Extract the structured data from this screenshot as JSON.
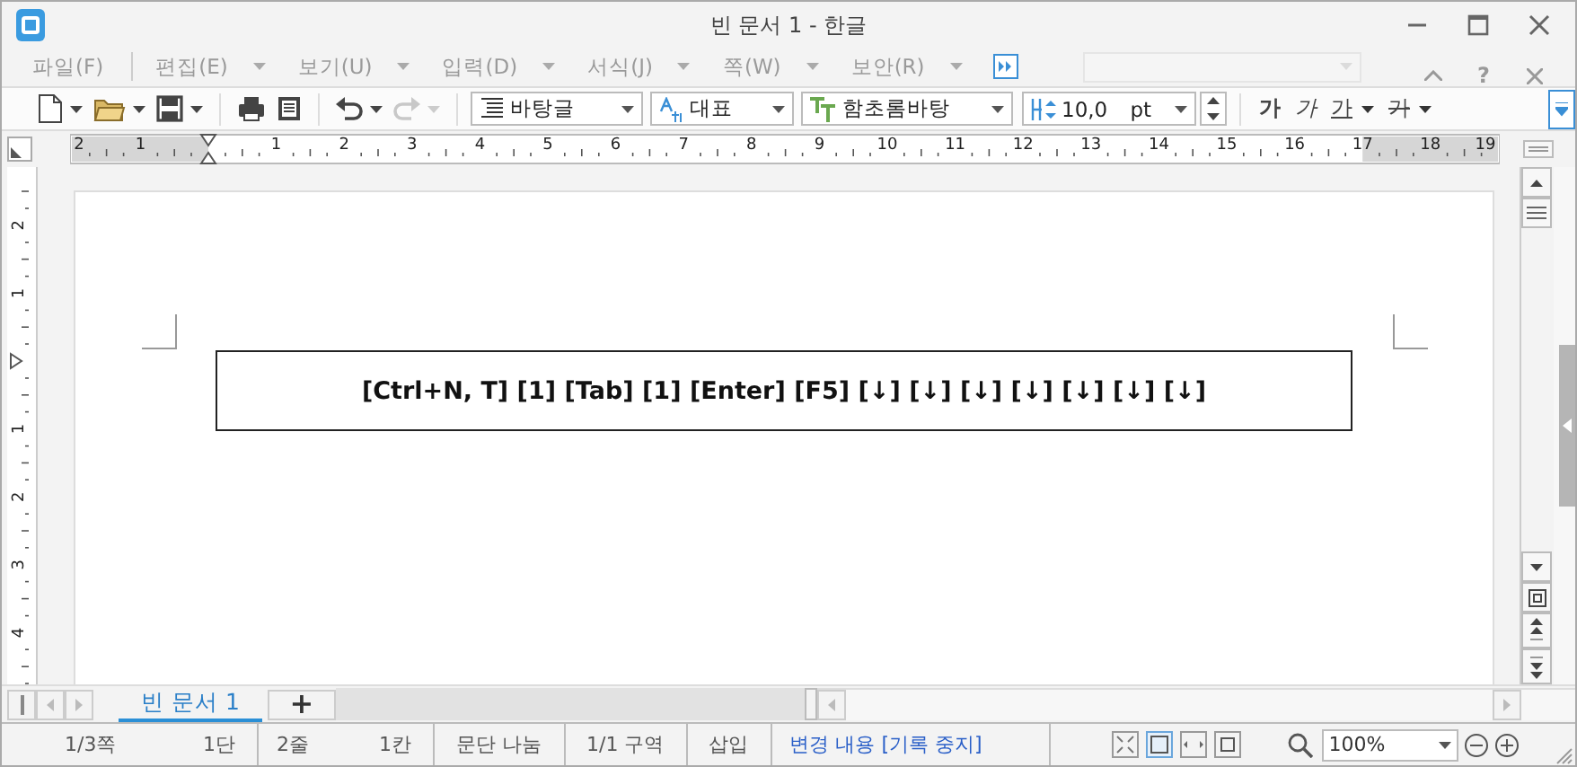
{
  "window": {
    "title": "빈 문서 1 - 한글"
  },
  "menu": [
    {
      "label": "파일(F)",
      "has_dropdown": false
    },
    {
      "label": "편집(E)",
      "has_dropdown": true
    },
    {
      "label": "보기(U)",
      "has_dropdown": true
    },
    {
      "label": "입력(D)",
      "has_dropdown": true
    },
    {
      "label": "서식(J)",
      "has_dropdown": true
    },
    {
      "label": "쪽(W)",
      "has_dropdown": true
    },
    {
      "label": "보안(R)",
      "has_dropdown": true
    }
  ],
  "menu_combo": {
    "disabled": true
  },
  "help_label": "?",
  "toolbar": {
    "tools": [
      {
        "kind": "new",
        "disabled": false,
        "has_dropdown": true
      },
      {
        "kind": "open",
        "disabled": false,
        "has_dropdown": true
      },
      {
        "kind": "save",
        "disabled": false,
        "has_dropdown": true
      },
      {
        "kind": "print",
        "disabled": false,
        "has_dropdown": false
      },
      {
        "kind": "preview",
        "disabled": false,
        "has_dropdown": false
      },
      {
        "kind": "undo",
        "disabled": false,
        "has_dropdown": true
      },
      {
        "kind": "redo",
        "disabled": true,
        "has_dropdown": true
      }
    ],
    "style": "바탕글",
    "language": "대표",
    "font": "함초롬바탕",
    "size": "10,0",
    "size_unit": "pt",
    "format_buttons": [
      {
        "label": "가",
        "kind": "bold",
        "has_dropdown": false
      },
      {
        "label": "가",
        "kind": "italic",
        "has_dropdown": false
      },
      {
        "label": "가",
        "kind": "underline",
        "has_dropdown": true
      },
      {
        "label": "가",
        "kind": "strike",
        "has_dropdown": true
      }
    ]
  },
  "ruler": {
    "left_labels": [
      "2",
      "1"
    ],
    "right_labels": [
      "1",
      "2",
      "3",
      "4",
      "5",
      "6",
      "7",
      "8",
      "9",
      "10",
      "11",
      "12",
      "13",
      "14",
      "15",
      "16",
      "17",
      "18",
      "19"
    ]
  },
  "vertical_ruler": {
    "left_labels": [
      "2",
      "1"
    ],
    "right_labels": [
      "1",
      "2",
      "3",
      "4"
    ]
  },
  "document": {
    "text": "[Ctrl+N, T] [1] [Tab] [1] [Enter] [F5] [↓] [↓] [↓] [↓] [↓] [↓] [↓]"
  },
  "doc_tabs": [
    {
      "label": "빈 문서 1",
      "selected": true
    }
  ],
  "new_tab_label": "+",
  "status_bar": {
    "cells": [
      {
        "parts": [
          "1/3쪽",
          "1단"
        ]
      },
      {
        "parts": [
          "2줄",
          "1칸"
        ]
      },
      {
        "parts": [
          "문단 나눔"
        ]
      },
      {
        "parts": [
          "1/1 구역"
        ]
      },
      {
        "parts": [
          "삽입"
        ]
      }
    ],
    "track_changes": "변경 내용 [기록 중지]",
    "views": [
      {
        "kind": "fit",
        "selected": false
      },
      {
        "kind": "page",
        "selected": true
      },
      {
        "kind": "width",
        "selected": false
      },
      {
        "kind": "actual",
        "selected": false
      }
    ],
    "zoom": "100%"
  }
}
